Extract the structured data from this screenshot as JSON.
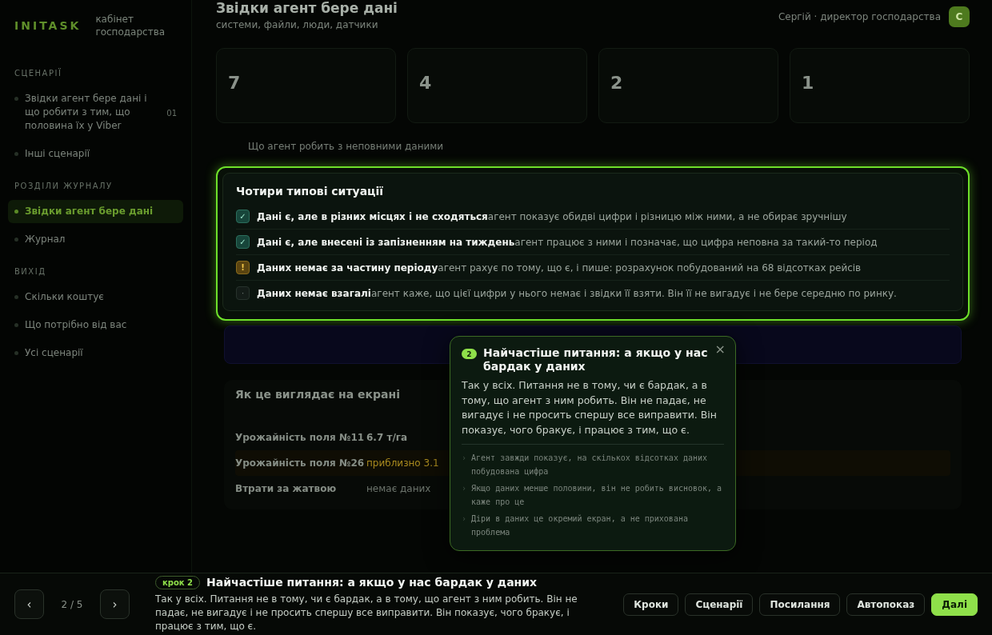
{
  "sidebar": {
    "logo": "INITASK",
    "subtitle": "кабінет господарства",
    "sections": [
      {
        "heading": "СЦЕНАРІЇ",
        "items": [
          {
            "label": "Звідки агент бере дані і що робити з тим, що половина їх у Viber",
            "badge": "01",
            "selected": false
          },
          {
            "label": "Інші сценарії",
            "selected": false
          }
        ]
      },
      {
        "heading": "РОЗДІЛИ ЖУРНАЛУ",
        "items": [
          {
            "label": "Звідки агент бере дані",
            "selected": true
          },
          {
            "label": "Журнал",
            "selected": false
          }
        ]
      },
      {
        "heading": "ВИХІД",
        "items": [
          {
            "label": "Скільки коштує",
            "selected": false
          },
          {
            "label": "Що потрібно від вас",
            "selected": false
          },
          {
            "label": "Усі сценарії",
            "selected": false
          }
        ]
      }
    ]
  },
  "header": {
    "title": "Звідки агент бере дані",
    "subtitle": "системи, файли, люди, датчики",
    "user": "Сергій · директор господарства",
    "avatar": "С"
  },
  "stats": [
    {
      "value": "7"
    },
    {
      "value": "4"
    },
    {
      "value": "2"
    },
    {
      "value": "1"
    }
  ],
  "section_title": "Що агент робить з неповними даними",
  "situations": {
    "title": "Чотири типові ситуації",
    "items": [
      {
        "kind": "ok",
        "mark": "✓",
        "title": "Дані є, але в різних місцях і не сходяться",
        "text": "агент показує обидві цифри і різницю між ними, а не обирає зручнішу"
      },
      {
        "kind": "ok",
        "mark": "✓",
        "title": "Дані є, але внесені із запізненням на тиждень",
        "text": "агент працює з ними і позначає, що цифра неповна за такий-то період"
      },
      {
        "kind": "partial",
        "mark": "!",
        "title": "Даних немає за частину періоду",
        "text": "агент рахує по тому, що є, і пише: розрахунок побудований на 68 відсотках рейсів"
      },
      {
        "kind": "none",
        "mark": "·",
        "title": "Даних немає взагалі",
        "text": "агент каже, що цієї цифри у нього немає і звідки її взяти. Він її не вигадує і не бере середню по ринку."
      }
    ]
  },
  "screen": {
    "title": "Як це виглядає на екрані",
    "rows": [
      {
        "name": "Урожайність поля №11",
        "value": "6.7 т/га",
        "kind": "normal"
      },
      {
        "name": "Урожайність поля №26",
        "value": "приблизно 3.1",
        "kind": "warn"
      },
      {
        "name": "Втрати за жатвою",
        "value": "немає даних",
        "kind": "muted"
      }
    ]
  },
  "popover": {
    "step": "2",
    "title": "Найчастіше питання: а якщо у нас бардак у даних",
    "close": "×",
    "body": "Так у всіх. Питання не в тому, чи є бардак, а в тому, що агент з ним робить. Він не падає, не вигадує і не просить спершу все виправити. Він показує, чого бракує, і працює з тим, що є.",
    "bullets": [
      {
        "mark": "›",
        "text": "Агент завжди показує, на скількох відсотках даних побудована цифра"
      },
      {
        "mark": "›",
        "text": "Якщо даних менше половини, він не робить висновок, а каже про це"
      },
      {
        "mark": "›",
        "text": "Діри в даних це окремий екран, а не прихована проблема"
      }
    ]
  },
  "bottom_bar": {
    "prev": "‹",
    "counter": "2 / 5",
    "next": "›",
    "step_badge": "крок 2",
    "title": "Найчастіше питання: а якщо у нас бардак у даних",
    "body": "Так у всіх. Питання не в тому, чи є бардак, а в тому, що агент з ним робить. Він не падає, не вигадує і не просить спершу все виправити. Він показує, чого бракує, і працює з тим, що є.",
    "buttons": [
      {
        "label": "Кроки",
        "primary": false
      },
      {
        "label": "Сценарії",
        "primary": false
      },
      {
        "label": "Посилання",
        "primary": false
      },
      {
        "label": "Автопоказ",
        "primary": false
      },
      {
        "label": "Далі",
        "primary": true
      }
    ]
  }
}
